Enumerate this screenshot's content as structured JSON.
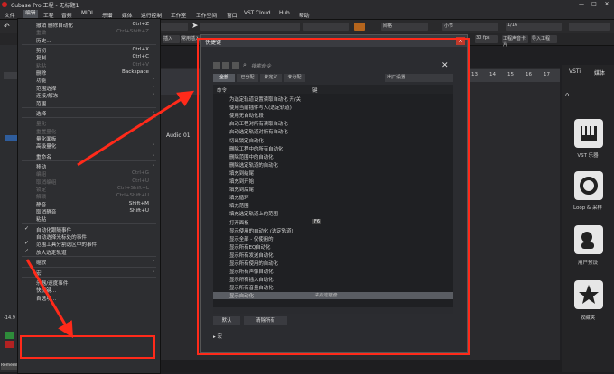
{
  "window": {
    "title": "Cubase Pro 工程 - 无标题1",
    "min": "—",
    "max": "□",
    "close": "✕"
  },
  "menubar": [
    "文件",
    "编辑",
    "工程",
    "音频",
    "MIDI",
    "乐谱",
    "媒体",
    "运行控制",
    "工作室",
    "工作空间",
    "窗口",
    "VST Cloud",
    "Hub",
    "帮助"
  ],
  "toolbar": {
    "snap": "网格",
    "quant": "小节",
    "grid_val": "1/16",
    "fps": "30 fps",
    "btn_a": "插入",
    "btn_b": "常用插入",
    "btn_c": "工程声音卡片",
    "btn_d": "导入工程"
  },
  "inspector": {
    "track_name": "Audio 01",
    "db": "-14.9",
    "remember": "Remember"
  },
  "edit_menu": [
    {
      "label": "撤销 删除自动化",
      "shortcut": "Ctrl+Z",
      "dis": false
    },
    {
      "label": "重做",
      "shortcut": "Ctrl+Shift+Z",
      "dis": true
    },
    {
      "label": "历史...",
      "shortcut": "",
      "dis": false
    },
    {
      "sep": true
    },
    {
      "label": "剪切",
      "shortcut": "Ctrl+X",
      "dis": false
    },
    {
      "label": "复制",
      "shortcut": "Ctrl+C",
      "dis": false
    },
    {
      "label": "粘贴",
      "shortcut": "Ctrl+V",
      "dis": true
    },
    {
      "label": "删除",
      "shortcut": "Backspace",
      "dis": false
    },
    {
      "label": "功能",
      "shortcut": "",
      "dis": false,
      "sub": true
    },
    {
      "label": "范围选择",
      "shortcut": "",
      "dis": false,
      "sub": true
    },
    {
      "label": "连接/解冻",
      "shortcut": "",
      "dis": false,
      "sub": true
    },
    {
      "label": "范围",
      "shortcut": "",
      "dis": false
    },
    {
      "sep": true
    },
    {
      "label": "选择",
      "shortcut": "",
      "dis": false,
      "sub": true
    },
    {
      "sep": true
    },
    {
      "label": "量化",
      "shortcut": "",
      "dis": true
    },
    {
      "label": "重置量化",
      "shortcut": "",
      "dis": true
    },
    {
      "label": "量化面板",
      "shortcut": "",
      "dis": false
    },
    {
      "label": "高级量化",
      "shortcut": "",
      "dis": false,
      "sub": true
    },
    {
      "sep": true
    },
    {
      "label": "重命名",
      "shortcut": "",
      "dis": false,
      "sub": true
    },
    {
      "sep": true
    },
    {
      "label": "移动",
      "shortcut": "",
      "dis": false,
      "sub": true
    },
    {
      "label": "编组",
      "shortcut": "Ctrl+G",
      "dis": true
    },
    {
      "label": "取消编组",
      "shortcut": "Ctrl+U",
      "dis": true
    },
    {
      "label": "锁定",
      "shortcut": "Ctrl+Shift+L",
      "dis": true
    },
    {
      "label": "解锁",
      "shortcut": "Ctrl+Shift+U",
      "dis": true
    },
    {
      "label": "静音",
      "shortcut": "Shift+M",
      "dis": false
    },
    {
      "label": "取消静音",
      "shortcut": "Shift+U",
      "dis": false
    },
    {
      "label": "粘贴",
      "shortcut": "",
      "dis": false
    },
    {
      "sep": true
    },
    {
      "label": "自动化跟随事件",
      "shortcut": "",
      "dis": false,
      "chk": true
    },
    {
      "label": "自动选择光标处的事件",
      "shortcut": "",
      "dis": false
    },
    {
      "label": "范围工具分割选区中的事件",
      "shortcut": "",
      "dis": false,
      "chk": true
    },
    {
      "label": "放大选定轨道",
      "shortcut": "",
      "dis": false,
      "chk": true
    },
    {
      "sep": true
    },
    {
      "label": "缩放",
      "shortcut": "",
      "dis": false,
      "sub": true
    },
    {
      "sep": true
    },
    {
      "label": "宏",
      "shortcut": "",
      "dis": false,
      "sub": true
    },
    {
      "sep": true
    },
    {
      "label": "乐器/速度事件",
      "shortcut": "",
      "dis": false
    },
    {
      "label": "快捷键...",
      "shortcut": "",
      "dis": false
    },
    {
      "label": "首选项...",
      "shortcut": "",
      "dis": false
    }
  ],
  "dialog": {
    "title": "快捷键",
    "search_placeholder": "搜索命令",
    "tabs": [
      "全部",
      "已分配",
      "未定义",
      "未分配"
    ],
    "preset": "出厂设置",
    "col_cmd": "命令",
    "col_key": "键",
    "rows": [
      {
        "n": "为选定轨道设置读取自动化 开/关",
        "k": ""
      },
      {
        "n": "使用当前插件写入(选定轨道)",
        "k": ""
      },
      {
        "n": "使用无自动化段",
        "k": ""
      },
      {
        "n": "启动工程对所有读取自动化",
        "k": ""
      },
      {
        "n": "启动选定轨道对所有自动化",
        "k": ""
      },
      {
        "n": "切出锁定自动化",
        "k": ""
      },
      {
        "n": "删除工程中的所有自动化",
        "k": ""
      },
      {
        "n": "删除范围中的自动化",
        "k": ""
      },
      {
        "n": "删除选定轨道的自动化",
        "k": ""
      },
      {
        "n": "填充到结尾",
        "k": ""
      },
      {
        "n": "填充到开始",
        "k": ""
      },
      {
        "n": "填充到后尾",
        "k": ""
      },
      {
        "n": "填充循环",
        "k": ""
      },
      {
        "n": "填充范围",
        "k": ""
      },
      {
        "n": "填充选定轨道上的范围",
        "k": ""
      },
      {
        "n": "打开面板",
        "k": "F6"
      },
      {
        "n": "显示使用的自动化 (选定轨道)",
        "k": ""
      },
      {
        "n": "显示全部 - 仅使用的",
        "k": ""
      },
      {
        "n": "显示所有EQ自动化",
        "k": ""
      },
      {
        "n": "显示所有发送自动化",
        "k": ""
      },
      {
        "n": "显示所有使用的自动化",
        "k": ""
      },
      {
        "n": "显示所有声像自动化",
        "k": ""
      },
      {
        "n": "显示所有插入自动化",
        "k": ""
      },
      {
        "n": "显示所有音量自动化",
        "k": ""
      },
      {
        "n": "显示自动化",
        "k": "",
        "sel": true
      }
    ],
    "sel_hint": "未指定键盘",
    "btn_default": "默认",
    "btn_clear": "清除所有",
    "macro_label": "宏"
  },
  "right_zone": {
    "tab_vsti": "VSTi",
    "tab_media": "媒体",
    "items": [
      "VST 乐器",
      "Loop & 采样",
      "用户预设",
      "收藏夹"
    ]
  },
  "project": {
    "track_label": "Audio 01",
    "ruler": [
      "13",
      "14",
      "15",
      "16",
      "17"
    ]
  }
}
